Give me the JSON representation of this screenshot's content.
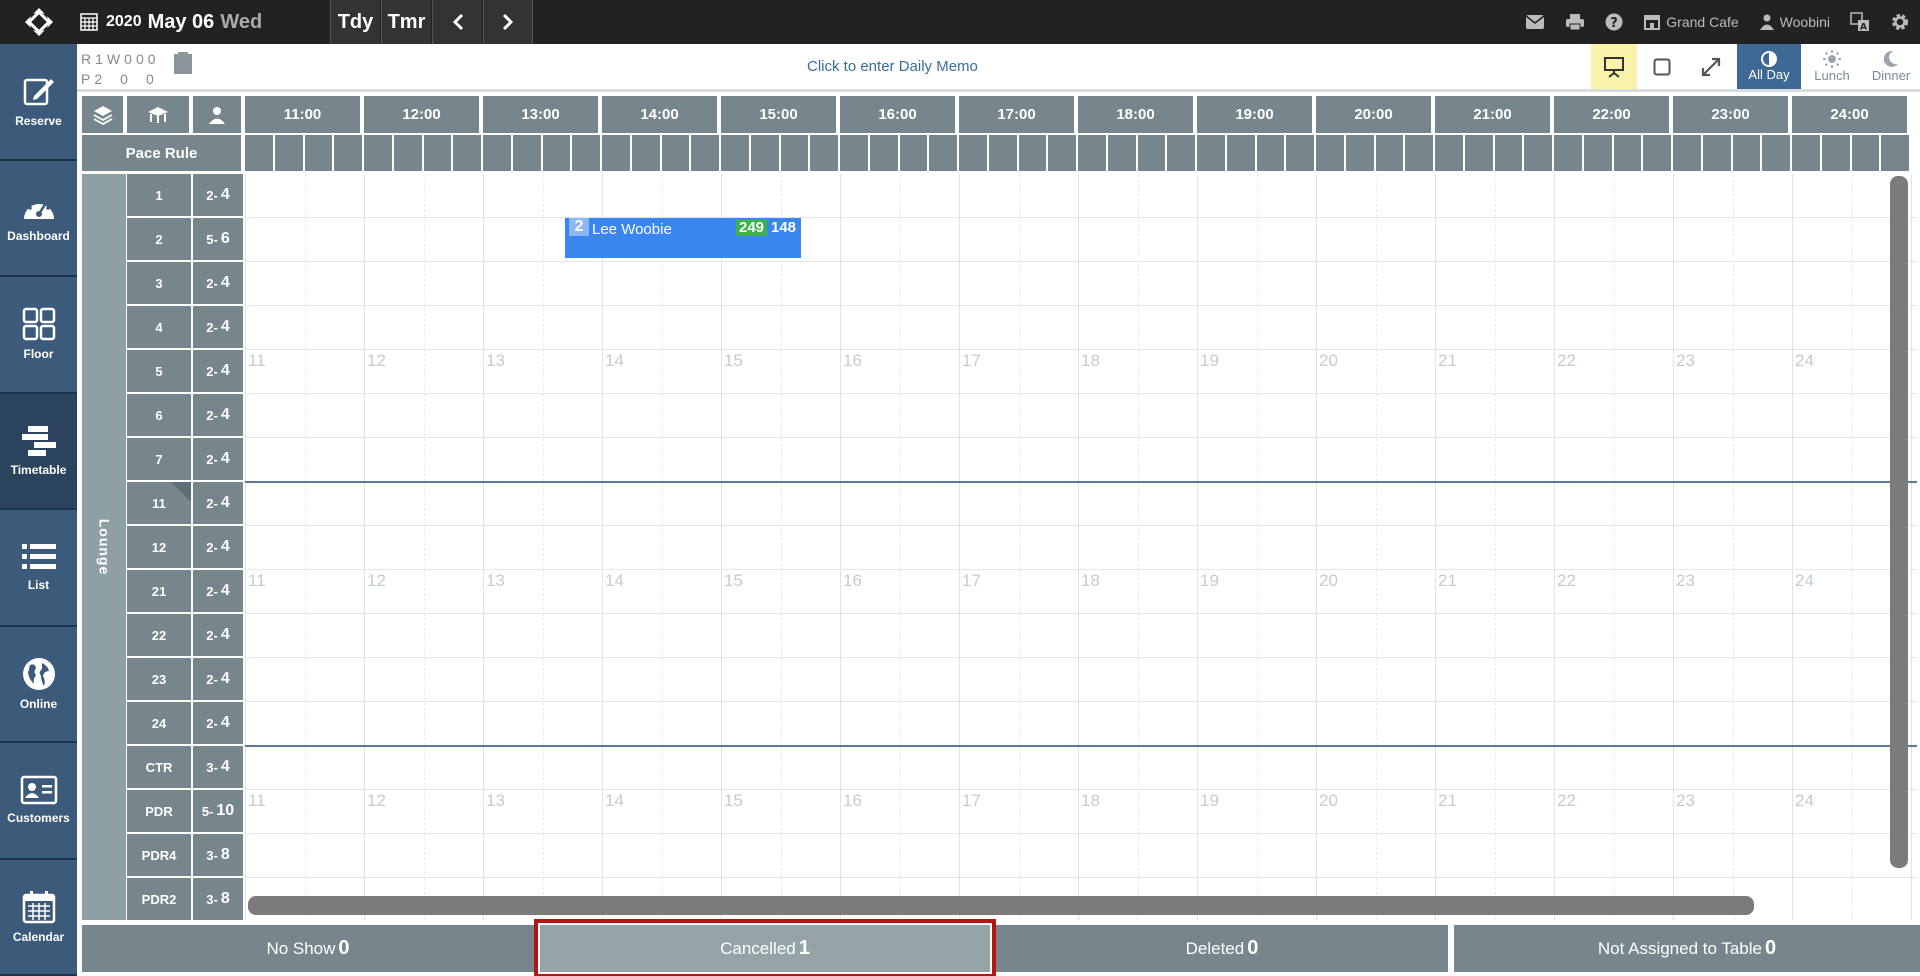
{
  "topbar": {
    "date_year": "2020",
    "date_monthday": "May 06",
    "date_weekday": "Wed",
    "today_label": "Tdy",
    "tomorrow_label": "Tmr",
    "venue": "Grand Cafe",
    "user": "Woobini"
  },
  "counters": {
    "r_label": "R",
    "r_values": [
      "1",
      "W",
      "0",
      "0",
      "0"
    ],
    "p_label": "P",
    "p_values": [
      "2",
      "0",
      "0"
    ]
  },
  "memo": "Click to enter Daily Memo",
  "view_buttons": {
    "all_day": "All Day",
    "lunch": "Lunch",
    "dinner": "Dinner"
  },
  "nav": [
    {
      "label": "Reserve",
      "icon": "reserve-icon"
    },
    {
      "label": "Dashboard",
      "icon": "dashboard-icon"
    },
    {
      "label": "Floor",
      "icon": "floor-icon"
    },
    {
      "label": "Timetable",
      "icon": "timetable-icon"
    },
    {
      "label": "List",
      "icon": "list-icon"
    },
    {
      "label": "Online",
      "icon": "globe-icon"
    },
    {
      "label": "Customers",
      "icon": "customers-icon"
    },
    {
      "label": "Calendar",
      "icon": "calendar-icon"
    }
  ],
  "times": [
    "11:00",
    "12:00",
    "13:00",
    "14:00",
    "15:00",
    "16:00",
    "17:00",
    "18:00",
    "19:00",
    "20:00",
    "21:00",
    "22:00",
    "23:00",
    "24:00"
  ],
  "hour_marks": [
    "11",
    "12",
    "13",
    "14",
    "15",
    "16",
    "17",
    "18",
    "19",
    "20",
    "21",
    "22",
    "23",
    "24"
  ],
  "pace_rule": "Pace Rule",
  "area": "Lounge",
  "tables": [
    {
      "name": "1",
      "min": "2",
      "max": "4"
    },
    {
      "name": "2",
      "min": "5",
      "max": "6"
    },
    {
      "name": "3",
      "min": "2",
      "max": "4"
    },
    {
      "name": "4",
      "min": "2",
      "max": "4"
    },
    {
      "name": "5",
      "min": "2",
      "max": "4"
    },
    {
      "name": "6",
      "min": "2",
      "max": "4"
    },
    {
      "name": "7",
      "min": "2",
      "max": "4"
    },
    {
      "name": "11",
      "min": "2",
      "max": "4"
    },
    {
      "name": "12",
      "min": "2",
      "max": "4"
    },
    {
      "name": "21",
      "min": "2",
      "max": "4"
    },
    {
      "name": "22",
      "min": "2",
      "max": "4"
    },
    {
      "name": "23",
      "min": "2",
      "max": "4"
    },
    {
      "name": "24",
      "min": "2",
      "max": "4"
    },
    {
      "name": "CTR",
      "min": "3",
      "max": "4"
    },
    {
      "name": "PDR",
      "min": "5",
      "max": "10"
    },
    {
      "name": "PDR4",
      "min": "3",
      "max": "8"
    },
    {
      "name": "PDR2",
      "min": "3",
      "max": "8"
    }
  ],
  "reservation": {
    "party": "2",
    "name": "Lee Woobie",
    "num1": "249",
    "num2": "148"
  },
  "bottom_tabs": {
    "no_show": {
      "label": "No Show",
      "count": "0"
    },
    "cancelled": {
      "label": "Cancelled",
      "count": "1"
    },
    "deleted": {
      "label": "Deleted",
      "count": "0"
    },
    "not_assigned": {
      "label": "Not Assigned to Table",
      "count": "0"
    }
  }
}
